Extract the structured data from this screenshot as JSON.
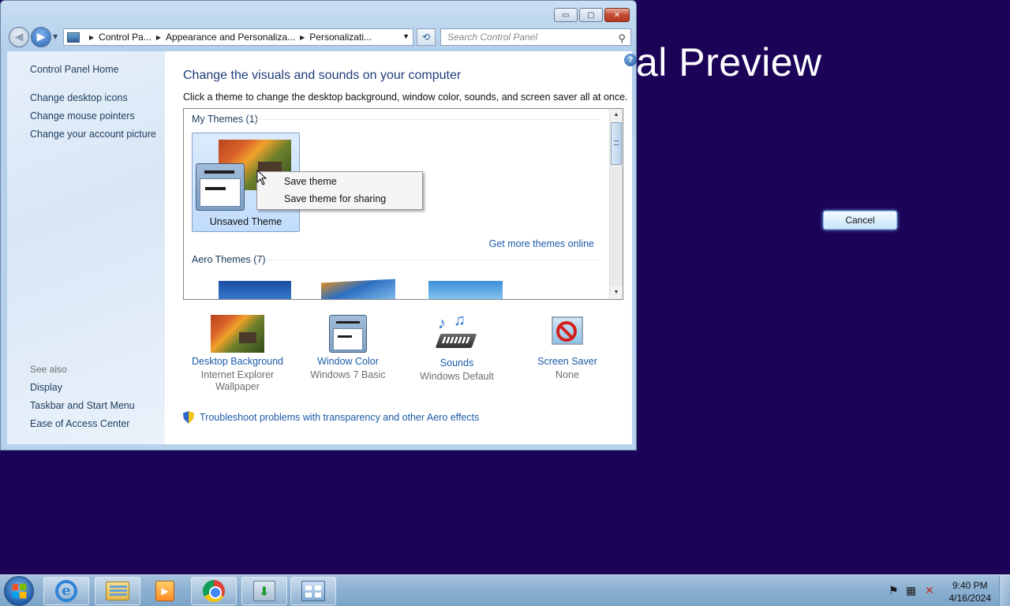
{
  "background": {
    "preview_text": "al Preview",
    "cancel_button": "Cancel"
  },
  "window": {
    "controls": {
      "minimize": "▭",
      "maximize": "▢",
      "close": "✕"
    },
    "address": {
      "crumbs": [
        "Control Pa...",
        "Appearance and Personaliza...",
        "Personalizati..."
      ]
    },
    "search_placeholder": "Search Control Panel"
  },
  "sidebar": {
    "home": "Control Panel Home",
    "links": [
      "Change desktop icons",
      "Change mouse pointers",
      "Change your account picture"
    ],
    "see_also_label": "See also",
    "see_also": [
      "Display",
      "Taskbar and Start Menu",
      "Ease of Access Center"
    ]
  },
  "main": {
    "heading": "Change the visuals and sounds on your computer",
    "subheading": "Click a theme to change the desktop background, window color, sounds, and screen saver all at once.",
    "my_themes_label": "My Themes (1)",
    "unsaved_theme_label": "Unsaved Theme",
    "get_more_link": "Get more themes online",
    "aero_themes_label": "Aero Themes (7)",
    "customize": [
      {
        "title": "Desktop Background",
        "sub": "Internet Explorer Wallpaper"
      },
      {
        "title": "Window Color",
        "sub": "Windows 7 Basic"
      },
      {
        "title": "Sounds",
        "sub": "Windows Default"
      },
      {
        "title": "Screen Saver",
        "sub": "None"
      }
    ],
    "troubleshoot_link": "Troubleshoot problems with transparency and other Aero effects"
  },
  "context_menu": {
    "items": [
      "Save theme",
      "Save theme for sharing"
    ]
  },
  "taskbar": {
    "time": "9:40 PM",
    "date": "4/16/2024"
  },
  "colors": {
    "desktop": "#1b0458",
    "link": "#1a5aa8",
    "heading": "#1f3d7a"
  }
}
